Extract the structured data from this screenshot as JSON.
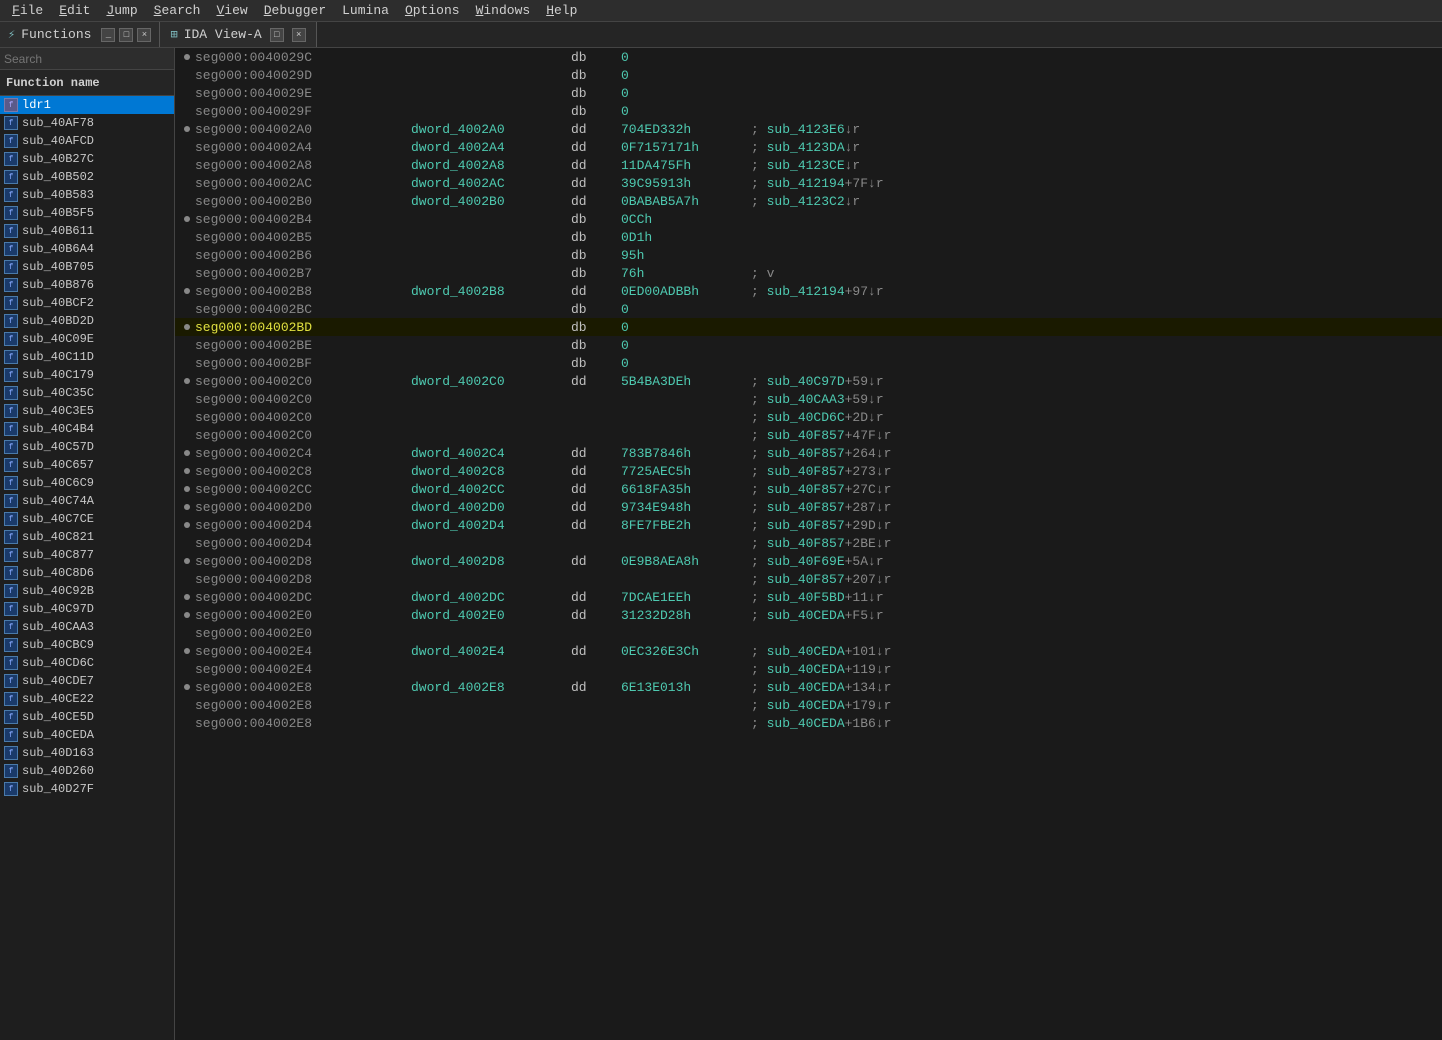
{
  "menu": {
    "items": [
      "File",
      "Edit",
      "Jump",
      "Search",
      "View",
      "Debugger",
      "Lumina",
      "Options",
      "Windows",
      "Help"
    ]
  },
  "functions_panel": {
    "title": "Functions",
    "search_placeholder": "Search",
    "column_header": "Function name",
    "items": [
      {
        "name": "ldr1",
        "selected": true
      },
      {
        "name": "sub_40AF78"
      },
      {
        "name": "sub_40AFCD"
      },
      {
        "name": "sub_40B27C"
      },
      {
        "name": "sub_40B502"
      },
      {
        "name": "sub_40B583"
      },
      {
        "name": "sub_40B5F5"
      },
      {
        "name": "sub_40B611"
      },
      {
        "name": "sub_40B6A4"
      },
      {
        "name": "sub_40B705"
      },
      {
        "name": "sub_40B876"
      },
      {
        "name": "sub_40BCF2"
      },
      {
        "name": "sub_40BD2D"
      },
      {
        "name": "sub_40C09E"
      },
      {
        "name": "sub_40C11D"
      },
      {
        "name": "sub_40C179"
      },
      {
        "name": "sub_40C35C"
      },
      {
        "name": "sub_40C3E5"
      },
      {
        "name": "sub_40C4B4"
      },
      {
        "name": "sub_40C57D"
      },
      {
        "name": "sub_40C657"
      },
      {
        "name": "sub_40C6C9"
      },
      {
        "name": "sub_40C74A"
      },
      {
        "name": "sub_40C7CE"
      },
      {
        "name": "sub_40C821"
      },
      {
        "name": "sub_40C877"
      },
      {
        "name": "sub_40C8D6"
      },
      {
        "name": "sub_40C92B"
      },
      {
        "name": "sub_40C97D"
      },
      {
        "name": "sub_40CAA3"
      },
      {
        "name": "sub_40CBC9"
      },
      {
        "name": "sub_40CD6C"
      },
      {
        "name": "sub_40CDE7"
      },
      {
        "name": "sub_40CE22"
      },
      {
        "name": "sub_40CE5D"
      },
      {
        "name": "sub_40CEDA"
      },
      {
        "name": "sub_40D163"
      },
      {
        "name": "sub_40D260"
      },
      {
        "name": "sub_40D27F"
      }
    ]
  },
  "view_title": "IDA View-A",
  "code_lines": [
    {
      "dot": true,
      "addr": "seg000:0040029C",
      "operand": "",
      "mnemonic": "db",
      "value": "0",
      "comment": ""
    },
    {
      "dot": false,
      "addr": "seg000:0040029D",
      "operand": "",
      "mnemonic": "db",
      "value": "0",
      "comment": ""
    },
    {
      "dot": false,
      "addr": "seg000:0040029E",
      "operand": "",
      "mnemonic": "db",
      "value": "0",
      "comment": ""
    },
    {
      "dot": false,
      "addr": "seg000:0040029F",
      "operand": "",
      "mnemonic": "db",
      "value": "0",
      "comment": ""
    },
    {
      "dot": true,
      "addr": "seg000:004002A0",
      "operand": "dword_4002A0",
      "mnemonic": "dd",
      "value": "704ED332h",
      "comment": "; sub_4123E6↓r"
    },
    {
      "dot": false,
      "addr": "seg000:004002A4",
      "operand": "dword_4002A4",
      "mnemonic": "dd",
      "value": "0F7157171h",
      "comment": "; sub_4123DA↓r"
    },
    {
      "dot": false,
      "addr": "seg000:004002A8",
      "operand": "dword_4002A8",
      "mnemonic": "dd",
      "value": "11DA475Fh",
      "comment": "; sub_4123CE↓r"
    },
    {
      "dot": false,
      "addr": "seg000:004002AC",
      "operand": "dword_4002AC",
      "mnemonic": "dd",
      "value": "39C95913h",
      "comment": "; sub_412194+7F↓r"
    },
    {
      "dot": false,
      "addr": "seg000:004002B0",
      "operand": "dword_4002B0",
      "mnemonic": "dd",
      "value": "0BABAB5A7h",
      "comment": "; sub_4123C2↓r"
    },
    {
      "dot": true,
      "addr": "seg000:004002B4",
      "operand": "",
      "mnemonic": "db",
      "value": "0CCh",
      "comment": ""
    },
    {
      "dot": false,
      "addr": "seg000:004002B5",
      "operand": "",
      "mnemonic": "db",
      "value": "0D1h",
      "comment": ""
    },
    {
      "dot": false,
      "addr": "seg000:004002B6",
      "operand": "",
      "mnemonic": "db",
      "value": "95h",
      "comment": ""
    },
    {
      "dot": false,
      "addr": "seg000:004002B7",
      "operand": "",
      "mnemonic": "db",
      "value": "76h",
      "comment": "; v"
    },
    {
      "dot": true,
      "addr": "seg000:004002B8",
      "operand": "dword_4002B8",
      "mnemonic": "dd",
      "value": "0ED00ADBBh",
      "comment": "; sub_412194+97↓r"
    },
    {
      "dot": false,
      "addr": "seg000:004002BC",
      "operand": "",
      "mnemonic": "db",
      "value": "0",
      "comment": ""
    },
    {
      "dot": true,
      "addr_highlight": true,
      "addr": "seg000:004002BD",
      "operand": "",
      "mnemonic": "db",
      "value": "0",
      "comment": ""
    },
    {
      "dot": false,
      "addr": "seg000:004002BE",
      "operand": "",
      "mnemonic": "db",
      "value": "0",
      "comment": ""
    },
    {
      "dot": false,
      "addr": "seg000:004002BF",
      "operand": "",
      "mnemonic": "db",
      "value": "0",
      "comment": ""
    },
    {
      "dot": true,
      "addr": "seg000:004002C0",
      "operand": "dword_4002C0",
      "mnemonic": "dd",
      "value": "5B4BA3DEh",
      "comment": "; sub_40C97D+59↓r"
    },
    {
      "dot": false,
      "addr": "seg000:004002C0",
      "operand": "",
      "mnemonic": "",
      "value": "",
      "comment": "; sub_40CAA3+59↓r"
    },
    {
      "dot": false,
      "addr": "seg000:004002C0",
      "operand": "",
      "mnemonic": "",
      "value": "",
      "comment": "; sub_40CD6C+2D↓r"
    },
    {
      "dot": false,
      "addr": "seg000:004002C0",
      "operand": "",
      "mnemonic": "",
      "value": "",
      "comment": "; sub_40F857+47F↓r"
    },
    {
      "dot": true,
      "addr": "seg000:004002C4",
      "operand": "dword_4002C4",
      "mnemonic": "dd",
      "value": "783B7846h",
      "comment": "; sub_40F857+264↓r"
    },
    {
      "dot": true,
      "addr": "seg000:004002C8",
      "operand": "dword_4002C8",
      "mnemonic": "dd",
      "value": "7725AEC5h",
      "comment": "; sub_40F857+273↓r"
    },
    {
      "dot": true,
      "addr": "seg000:004002CC",
      "operand": "dword_4002CC",
      "mnemonic": "dd",
      "value": "6618FA35h",
      "comment": "; sub_40F857+27C↓r"
    },
    {
      "dot": true,
      "addr": "seg000:004002D0",
      "operand": "dword_4002D0",
      "mnemonic": "dd",
      "value": "9734E948h",
      "comment": "; sub_40F857+287↓r"
    },
    {
      "dot": true,
      "addr": "seg000:004002D4",
      "operand": "dword_4002D4",
      "mnemonic": "dd",
      "value": "8FE7FBE2h",
      "comment": "; sub_40F857+29D↓r"
    },
    {
      "dot": false,
      "addr": "seg000:004002D4",
      "operand": "",
      "mnemonic": "",
      "value": "",
      "comment": "; sub_40F857+2BE↓r"
    },
    {
      "dot": true,
      "addr": "seg000:004002D8",
      "operand": "dword_4002D8",
      "mnemonic": "dd",
      "value": "0E9B8AEA8h",
      "comment": "; sub_40F69E+5A↓r"
    },
    {
      "dot": false,
      "addr": "seg000:004002D8",
      "operand": "",
      "mnemonic": "",
      "value": "",
      "comment": "; sub_40F857+207↓r"
    },
    {
      "dot": true,
      "addr": "seg000:004002DC",
      "operand": "dword_4002DC",
      "mnemonic": "dd",
      "value": "7DCAE1EEh",
      "comment": "; sub_40F5BD+11↓r"
    },
    {
      "dot": true,
      "addr": "seg000:004002E0",
      "operand": "dword_4002E0",
      "mnemonic": "dd",
      "value": "31232D28h",
      "comment": "; sub_40CEDA+F5↓r"
    },
    {
      "dot": false,
      "addr": "seg000:004002E0",
      "operand": "",
      "mnemonic": "",
      "value": "",
      "comment": ""
    },
    {
      "dot": true,
      "addr": "seg000:004002E4",
      "operand": "dword_4002E4",
      "mnemonic": "dd",
      "value": "0EC326E3Ch",
      "comment": "; sub_40CEDA+101↓r"
    },
    {
      "dot": false,
      "addr": "seg000:004002E4",
      "operand": "",
      "mnemonic": "",
      "value": "",
      "comment": "; sub_40CEDA+119↓r"
    },
    {
      "dot": true,
      "addr": "seg000:004002E8",
      "operand": "dword_4002E8",
      "mnemonic": "dd",
      "value": "6E13E013h",
      "comment": "; sub_40CEDA+134↓r"
    },
    {
      "dot": false,
      "addr": "seg000:004002E8",
      "operand": "",
      "mnemonic": "",
      "value": "",
      "comment": "; sub_40CEDA+179↓r"
    },
    {
      "dot": false,
      "addr": "seg000:004002E8",
      "operand": "",
      "mnemonic": "",
      "value": "",
      "comment": "; sub_40CEDA+1B6↓r"
    }
  ]
}
